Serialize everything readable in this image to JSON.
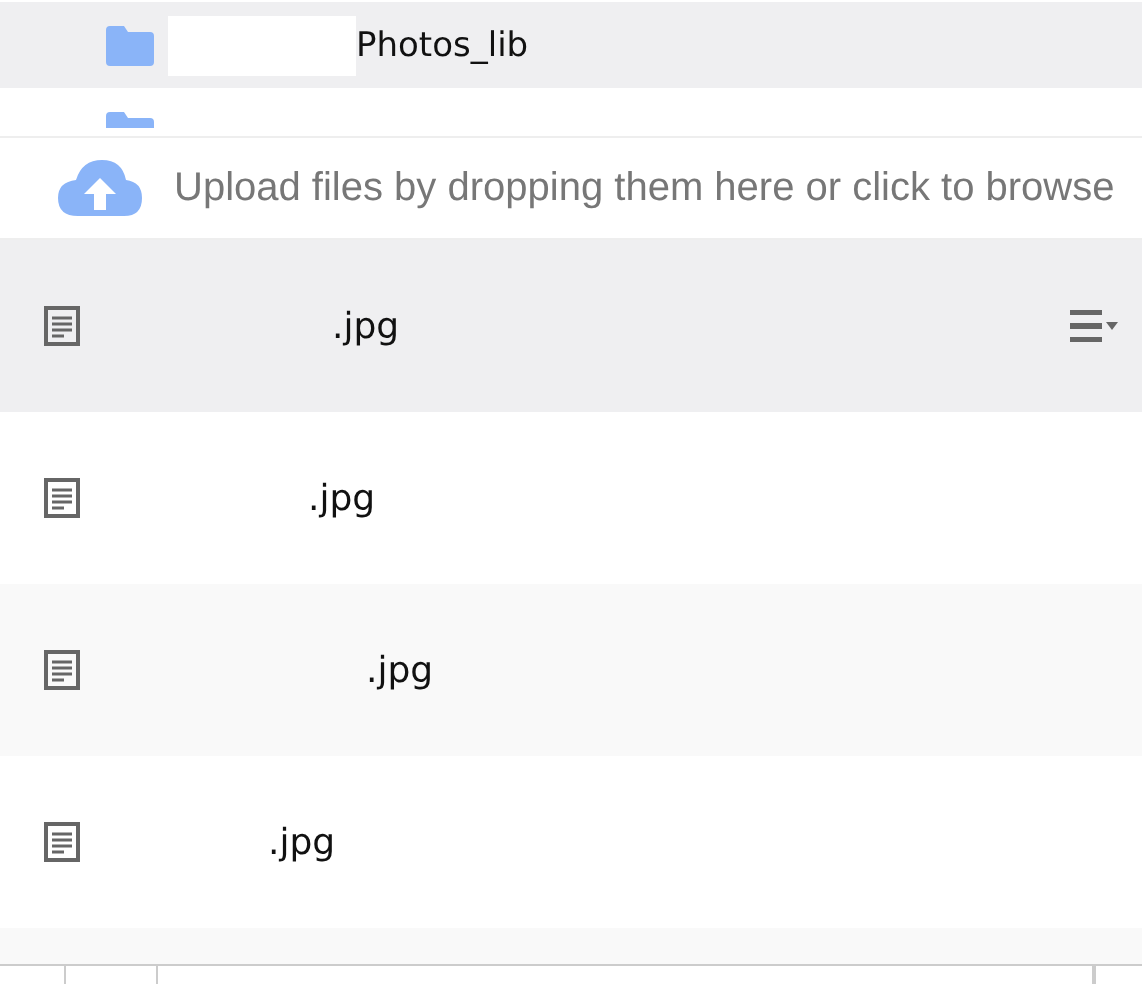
{
  "tree": [
    {
      "name": "Photos_lib",
      "selected": true
    },
    {
      "selected": false
    }
  ],
  "upload": {
    "text": "Upload files by dropping them here or click to browse"
  },
  "files": [
    {
      "name": ".jpg",
      "selected": true
    },
    {
      "name": ".jpg",
      "selected": false
    },
    {
      "name": ".jpg",
      "selected": false
    },
    {
      "name": ".jpg",
      "selected": false
    }
  ]
}
